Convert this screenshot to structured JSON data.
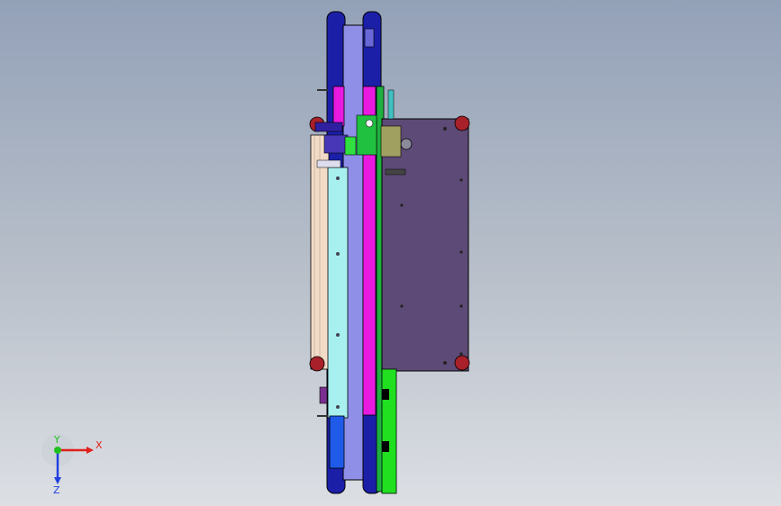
{
  "viewport": {
    "background_top": "#93a1b8",
    "background_bottom": "#dcdfe4"
  },
  "triad": {
    "x_label": "X",
    "y_label": "Y",
    "z_label": "Z",
    "x_color": "#e0201a",
    "y_color": "#20c020",
    "z_color": "#2040e0"
  },
  "colors": {
    "navy": "#1b1fa8",
    "violet": "#8f8fe8",
    "magenta": "#e81ae0",
    "cyan": "#a8f0f0",
    "cream": "#f2dcc8",
    "plate": "#5e4a76",
    "green": "#20d020",
    "blue": "#1f5ae8",
    "red": "#a8202a"
  }
}
